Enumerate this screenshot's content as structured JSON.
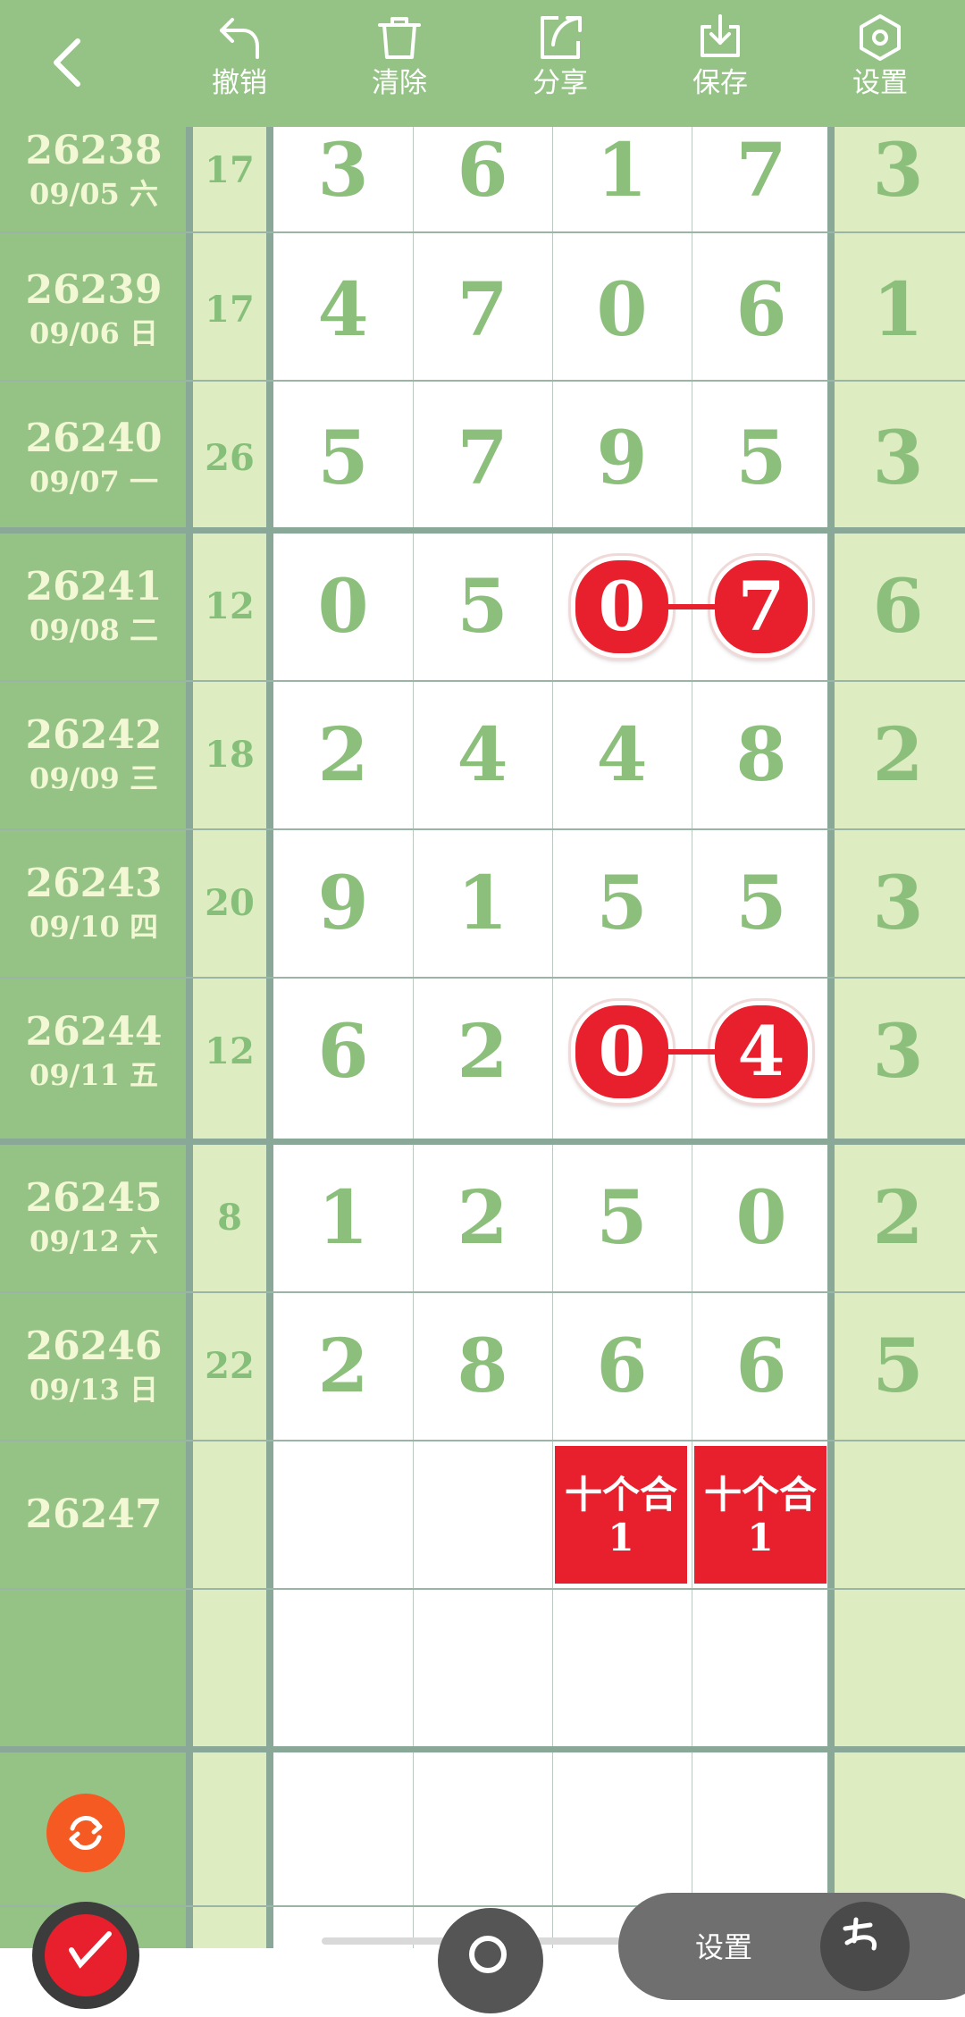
{
  "toolbar": {
    "back_icon": "chevron-left-icon",
    "tools": [
      {
        "label": "撤销",
        "icon": "undo-icon"
      },
      {
        "label": "清除",
        "icon": "trash-icon"
      },
      {
        "label": "分享",
        "icon": "share-icon"
      },
      {
        "label": "保存",
        "icon": "download-icon"
      },
      {
        "label": "设置",
        "icon": "hexagon-settings-icon"
      }
    ]
  },
  "colors": {
    "toolbar_bg": "#95c386",
    "issue_column_bg": "#95c386",
    "light_column_bg": "#ddedc1",
    "digit_color": "#8dbf7c",
    "highlight_red": "#e8202d",
    "refresh_button": "#f45a22"
  },
  "rows": [
    {
      "issue": "26238",
      "date": "09/05 六",
      "sum": "17",
      "digits": [
        "3",
        "6",
        "1",
        "7"
      ],
      "last": "3"
    },
    {
      "issue": "26239",
      "date": "09/06 日",
      "sum": "17",
      "digits": [
        "4",
        "7",
        "0",
        "6"
      ],
      "last": "1"
    },
    {
      "issue": "26240",
      "date": "09/07 一",
      "sum": "26",
      "digits": [
        "5",
        "7",
        "9",
        "5"
      ],
      "last": "3"
    },
    {
      "issue": "26241",
      "date": "09/08 二",
      "sum": "12",
      "digits": [
        "0",
        "5",
        "0",
        "7"
      ],
      "last": "6",
      "highlight": [
        2,
        3
      ]
    },
    {
      "issue": "26242",
      "date": "09/09 三",
      "sum": "18",
      "digits": [
        "2",
        "4",
        "4",
        "8"
      ],
      "last": "2"
    },
    {
      "issue": "26243",
      "date": "09/10 四",
      "sum": "20",
      "digits": [
        "9",
        "1",
        "5",
        "5"
      ],
      "last": "3"
    },
    {
      "issue": "26244",
      "date": "09/11 五",
      "sum": "12",
      "digits": [
        "6",
        "2",
        "0",
        "4"
      ],
      "last": "3",
      "highlight": [
        2,
        3
      ]
    },
    {
      "issue": "26245",
      "date": "09/12 六",
      "sum": "8",
      "digits": [
        "1",
        "2",
        "5",
        "0"
      ],
      "last": "2"
    },
    {
      "issue": "26246",
      "date": "09/13 日",
      "sum": "22",
      "digits": [
        "2",
        "8",
        "6",
        "6"
      ],
      "last": "5"
    }
  ],
  "pending": {
    "issue": "26247",
    "predictions": [
      {
        "text": "十个合",
        "value": "1"
      },
      {
        "text": "十个合",
        "value": "1"
      }
    ]
  },
  "floating": {
    "refresh_icon": "refresh-icon",
    "pen_icon": "pen-icon",
    "search_icon": "search-icon",
    "panel_text": "设置",
    "panel_icon": "handwriting-icon"
  }
}
